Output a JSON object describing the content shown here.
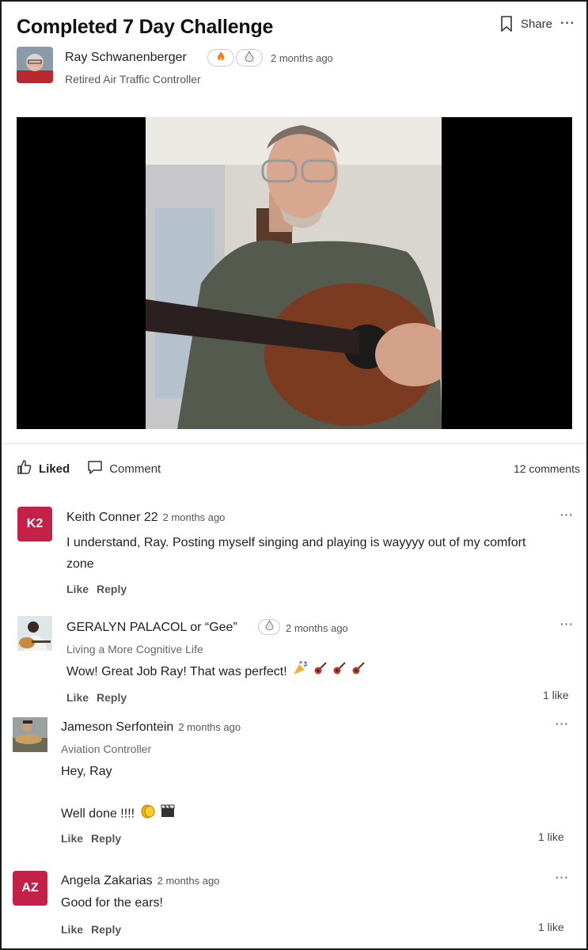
{
  "post": {
    "title": "Completed 7 Day Challenge",
    "share_label": "Share",
    "more": "···",
    "author": {
      "name": "Ray Schwanenberger",
      "time": "2 months ago",
      "role": "Retired Air Traffic Controller"
    }
  },
  "actions": {
    "liked_label": "Liked",
    "comment_label": "Comment",
    "comment_count": "12 comments"
  },
  "comments": [
    {
      "initials": "K2",
      "name": "Keith Conner 22",
      "time": "2 months ago",
      "text": "I understand, Ray. Posting myself singing and playing is wayyyy out of my comfort zone",
      "like_label": "Like",
      "reply_label": "Reply",
      "more": "···"
    },
    {
      "name": "GERALYN PALACOL or “Gee”",
      "time": "2 months ago",
      "role": "Living a More Cognitive Life",
      "text": "Wow! Great Job Ray!  That was perfect!",
      "like_label": "Like",
      "reply_label": "Reply",
      "likes": "1 like",
      "more": "···"
    },
    {
      "name": "Jameson Serfontein",
      "time": "2 months ago",
      "role": "Aviation Controller",
      "text1": "Hey, Ray",
      "text2": "Well done !!!!",
      "like_label": "Like",
      "reply_label": "Reply",
      "likes": "1 like",
      "more": "···"
    },
    {
      "initials": "AZ",
      "name": "Angela Zakarias",
      "time": "2 months ago",
      "text": "Good for the ears!",
      "like_label": "Like",
      "reply_label": "Reply",
      "likes": "1 like",
      "more": "···"
    }
  ],
  "colors": {
    "avatar_initials_bg": "#c32148",
    "divider": "#e3e3e3"
  },
  "icons": [
    "bookmark-icon",
    "more-icon",
    "fire-icon",
    "drop-icon",
    "thumbs-up-icon",
    "comment-icon",
    "guitar-icon",
    "party-popper-icon",
    "clapping-hands-icon",
    "clapper-board-icon"
  ]
}
